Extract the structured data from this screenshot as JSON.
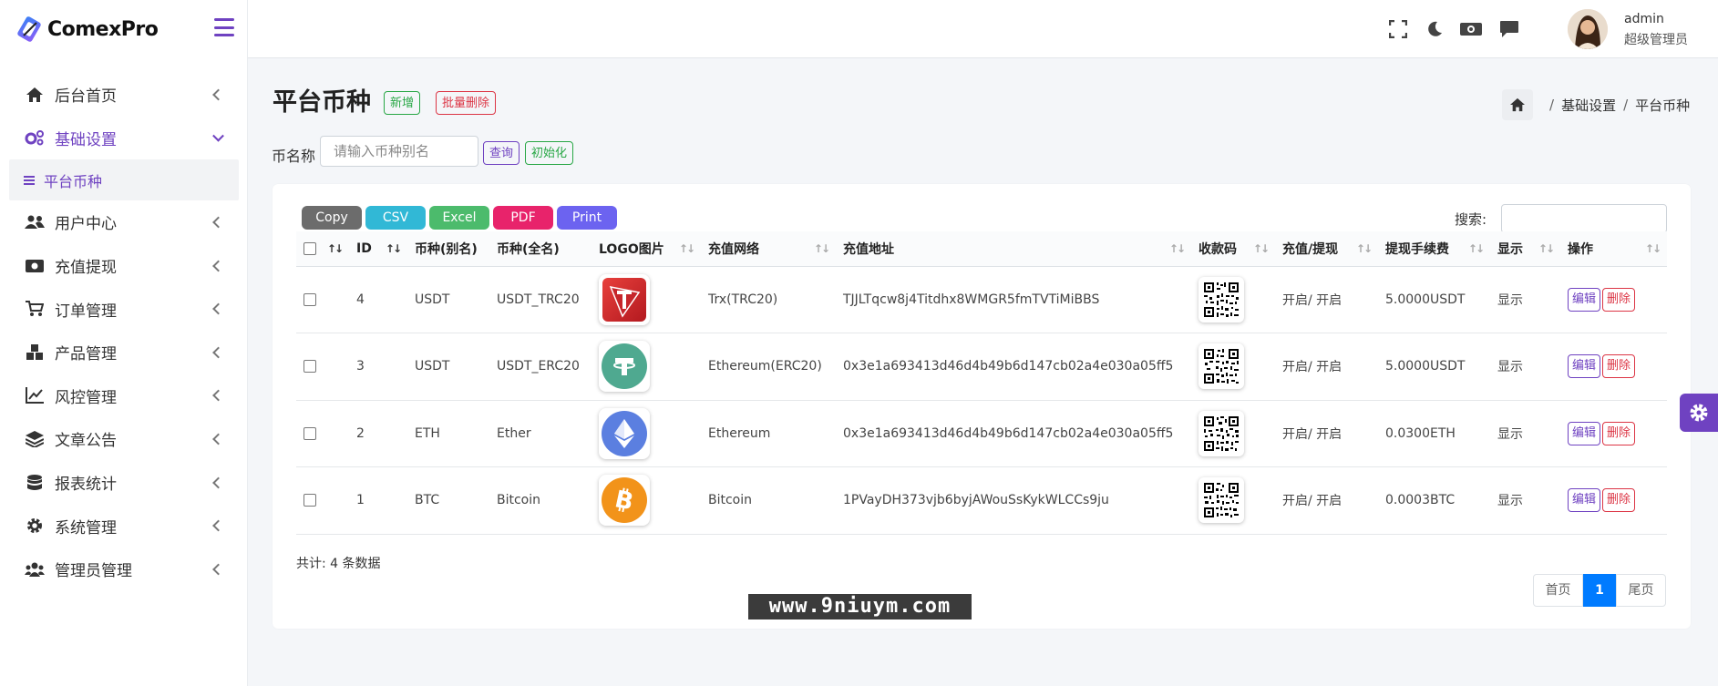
{
  "brand": {
    "name": "ComexPro"
  },
  "sidebar": {
    "items": [
      {
        "label": "后台首页",
        "icon": "home-icon"
      },
      {
        "label": "基础设置",
        "icon": "cogs-icon",
        "open": true
      },
      {
        "label": "用户中心",
        "icon": "users-icon"
      },
      {
        "label": "充值提现",
        "icon": "money-icon"
      },
      {
        "label": "订单管理",
        "icon": "cart-icon"
      },
      {
        "label": "产品管理",
        "icon": "cubes-icon"
      },
      {
        "label": "风控管理",
        "icon": "chart-line-icon"
      },
      {
        "label": "文章公告",
        "icon": "layers-icon"
      },
      {
        "label": "报表统计",
        "icon": "database-icon"
      },
      {
        "label": "系统管理",
        "icon": "gear-icon"
      },
      {
        "label": "管理员管理",
        "icon": "user-group-icon"
      }
    ],
    "submenu": {
      "label": "平台币种"
    }
  },
  "topbar": {
    "user_name": "admin",
    "user_role": "超级管理员",
    "icons": [
      "fullscreen-icon",
      "moon-icon",
      "money-bill-icon",
      "comment-icon"
    ]
  },
  "page": {
    "title": "平台币种",
    "add_label": "新增",
    "batch_delete_label": "批量删除",
    "breadcrumb": {
      "level1": "基础设置",
      "level2": "平台币种"
    }
  },
  "filter": {
    "label": "币名称",
    "placeholder": "请输入币种别名",
    "query_label": "查询",
    "init_label": "初始化"
  },
  "toolbar": {
    "buttons": [
      {
        "label": "Copy",
        "color": "#6c6c6c"
      },
      {
        "label": "CSV",
        "color": "#31b8d6"
      },
      {
        "label": "Excel",
        "color": "#4cbb6c"
      },
      {
        "label": "PDF",
        "color": "#e8236b"
      },
      {
        "label": "Print",
        "color": "#6c63f0"
      }
    ],
    "search_label": "搜索:"
  },
  "table": {
    "columns": [
      "ID",
      "币种(别名)",
      "币种(全名)",
      "LOGO图片",
      "充值网络",
      "充值地址",
      "收款码",
      "充值/提现",
      "提现手续费",
      "显示",
      "操作"
    ],
    "rows": [
      {
        "id": "4",
        "alias": "USDT",
        "full": "USDT_TRC20",
        "logo": "tron-icon",
        "network": "Trx(TRC20)",
        "address": "TJJLTqcw8j4Titdhx8WMGR5fmTVTiMiBBS",
        "status": "开启/ 开启",
        "fee": "5.0000USDT",
        "show": "显示",
        "edit": "编辑",
        "delete": "删除"
      },
      {
        "id": "3",
        "alias": "USDT",
        "full": "USDT_ERC20",
        "logo": "tether-icon",
        "network": "Ethereum(ERC20)",
        "address": "0x3e1a693413d46d4b49b6d147cb02a4e030a05ff5",
        "status": "开启/ 开启",
        "fee": "5.0000USDT",
        "show": "显示",
        "edit": "编辑",
        "delete": "删除"
      },
      {
        "id": "2",
        "alias": "ETH",
        "full": "Ether",
        "logo": "ethereum-icon",
        "network": "Ethereum",
        "address": "0x3e1a693413d46d4b49b6d147cb02a4e030a05ff5",
        "status": "开启/ 开启",
        "fee": "0.0300ETH",
        "show": "显示",
        "edit": "编辑",
        "delete": "删除"
      },
      {
        "id": "1",
        "alias": "BTC",
        "full": "Bitcoin",
        "logo": "bitcoin-icon",
        "network": "Bitcoin",
        "address": "1PVayDH373vjb6byjAWouSsKykWLCCs9ju",
        "status": "开启/ 开启",
        "fee": "0.0003BTC",
        "show": "显示",
        "edit": "编辑",
        "delete": "删除"
      }
    ],
    "total": "共计: 4 条数据"
  },
  "pagination": {
    "first": "首页",
    "current": "1",
    "last": "尾页"
  },
  "watermark": "www.9niuym.com",
  "colors": {
    "accent": "#6f42c1",
    "primary": "#007bff",
    "success": "#28a745",
    "danger": "#dc3545"
  }
}
